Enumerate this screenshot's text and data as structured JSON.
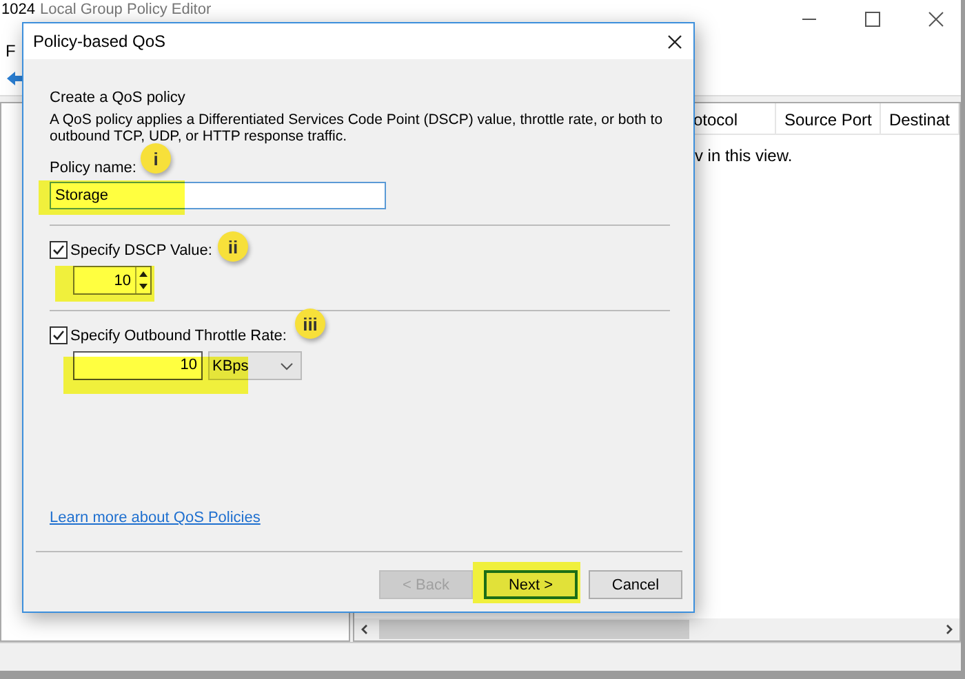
{
  "corner_label": "1024",
  "window": {
    "title": "Local Group Policy Editor",
    "menu": [
      "F"
    ],
    "columns": [
      "otocol",
      "Source Port",
      "Destinat"
    ],
    "empty_message": "v in this view."
  },
  "dialog": {
    "title": "Policy-based QoS",
    "heading": "Create a QoS policy",
    "description": "A QoS policy applies a Differentiated Services Code Point (DSCP) value, throttle rate, or both to outbound TCP, UDP, or HTTP response traffic.",
    "policy_name": {
      "label": "Policy name:",
      "value": "Storage"
    },
    "dscp": {
      "label": "Specify DSCP Value:",
      "checked": true,
      "value": "10"
    },
    "throttle": {
      "label": "Specify Outbound Throttle Rate:",
      "checked": true,
      "value": "10",
      "unit": "KBps"
    },
    "link": "Learn more about QoS Policies",
    "buttons": [
      {
        "label": "< Back",
        "disabled": true,
        "default": false
      },
      {
        "label": "Next >",
        "disabled": false,
        "default": true
      },
      {
        "label": "Cancel",
        "disabled": false,
        "default": false
      }
    ]
  },
  "annotations": [
    {
      "label": "i"
    },
    {
      "label": "ii"
    },
    {
      "label": "iii"
    }
  ]
}
